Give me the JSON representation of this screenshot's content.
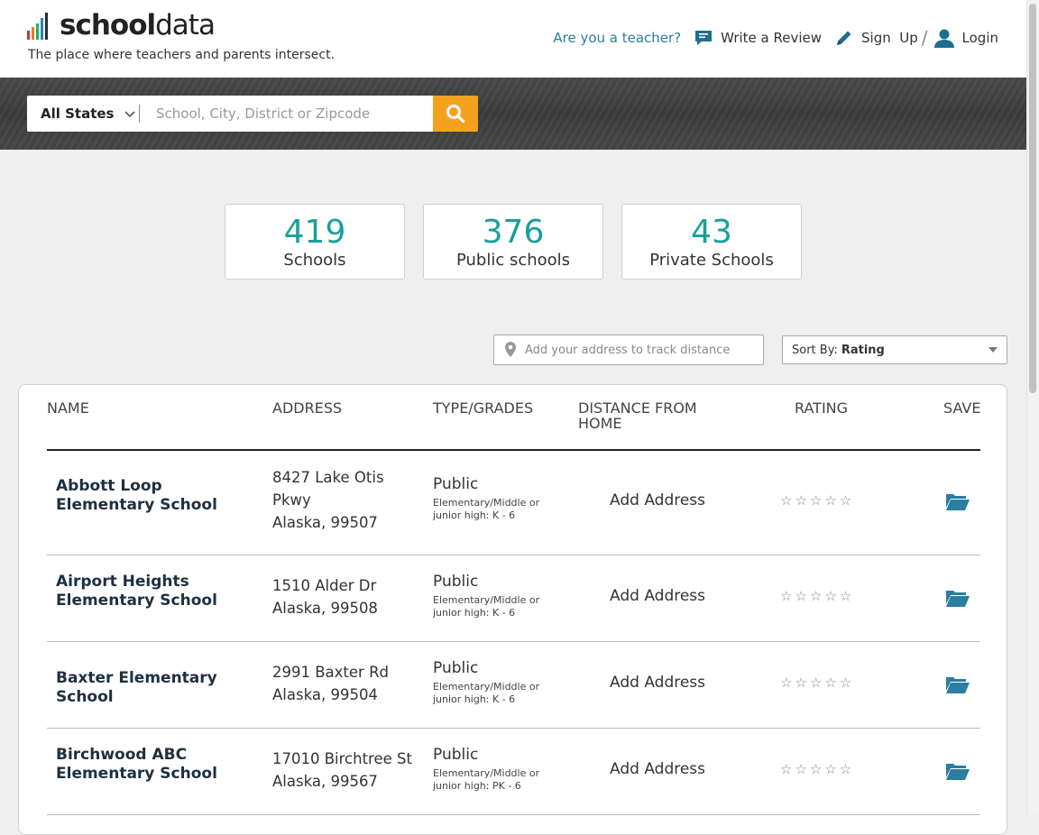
{
  "brand": {
    "logo_bold": "school",
    "logo_light": "data",
    "tagline": "The place where teachers and parents intersect."
  },
  "nav": {
    "teacher_link": "Are you a teacher?",
    "write_review": "Write a Review",
    "sign_up": "Sign  Up",
    "separator": "/",
    "login": "Login"
  },
  "search": {
    "state": "All States",
    "placeholder": "School, City, District or Zipcode"
  },
  "stats": [
    {
      "value": "419",
      "label": "Schools"
    },
    {
      "value": "376",
      "label": "Public schools"
    },
    {
      "value": "43",
      "label": "Private Schools"
    }
  ],
  "filters": {
    "address_placeholder": "Add your address to track distance",
    "sort_prefix": "Sort By:",
    "sort_value": "Rating"
  },
  "table": {
    "headers": {
      "name": "NAME",
      "address": "ADDRESS",
      "type": "TYPE/GRADES",
      "distance_line1": "DISTANCE FROM",
      "distance_line2": "HOME",
      "rating": "RATING",
      "save": "SAVE"
    },
    "rows": [
      {
        "name": "Abbott Loop Elementary School",
        "address_line1": "8427 Lake Otis Pkwy",
        "address_line2": "Alaska, 99507",
        "type": "Public",
        "grades": "Elementary/Middle or junior high: K - 6",
        "distance": "Add Address",
        "rating_stars": "☆☆☆☆☆"
      },
      {
        "name": "Airport Heights Elementary School",
        "address_line1": "1510 Alder Dr",
        "address_line2": "Alaska, 99508",
        "type": "Public",
        "grades": "Elementary/Middle or junior high: K - 6",
        "distance": "Add Address",
        "rating_stars": "☆☆☆☆☆"
      },
      {
        "name": "Baxter Elementary School",
        "address_line1": "2991 Baxter Rd",
        "address_line2": "Alaska, 99504",
        "type": "Public",
        "grades": "Elementary/Middle or junior high: K - 6",
        "distance": "Add Address",
        "rating_stars": "☆☆☆☆☆"
      },
      {
        "name": "Birchwood ABC Elementary School",
        "address_line1": "17010 Birchtree St",
        "address_line2": "Alaska, 99567",
        "type": "Public",
        "grades": "Elementary/Middle or junior high: PK - 6",
        "distance": "Add Address",
        "rating_stars": "☆☆☆☆☆"
      }
    ]
  },
  "colors": {
    "accent_teal": "#19a09a",
    "link_blue": "#2a7ea0",
    "search_orange": "#f4a11e",
    "folder_blue": "#2a7ea0"
  },
  "icons": [
    "search-icon",
    "chevron-down-icon",
    "chat-icon",
    "pencil-icon",
    "user-icon",
    "location-pin-icon",
    "star-icon",
    "folder-open-icon"
  ]
}
